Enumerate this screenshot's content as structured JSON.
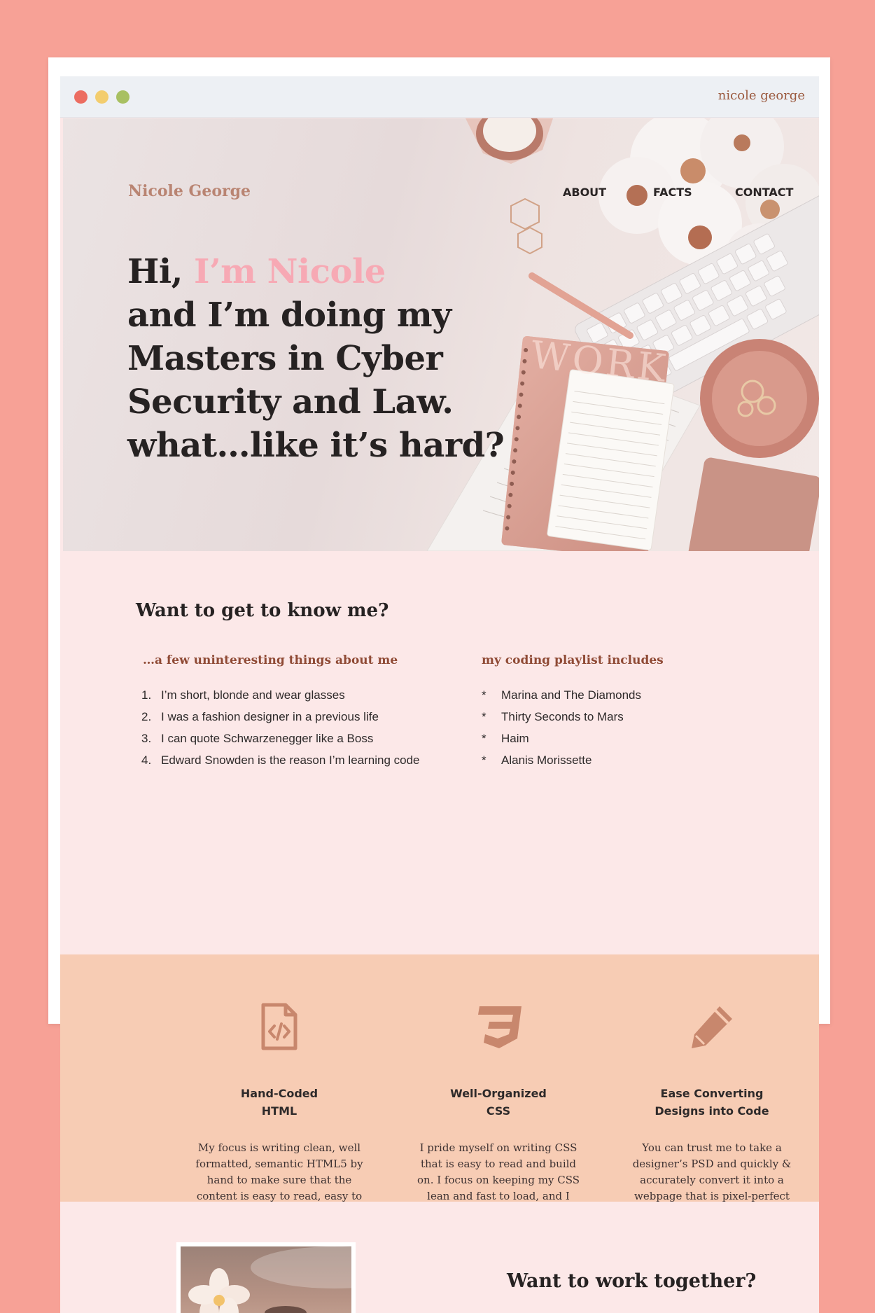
{
  "window": {
    "title": "nicole george"
  },
  "header": {
    "brand": "Nicole George",
    "nav": [
      "ABOUT",
      "FACTS",
      "CONTACT"
    ]
  },
  "hero": {
    "greeting": "Hi,",
    "name": "I’m Nicole",
    "lines": [
      "and I’m doing my",
      "Masters in Cyber",
      "Security and Law.",
      "what…like it’s hard?"
    ],
    "notebook_text": "WORK"
  },
  "about": {
    "heading": "Want to get to know me?",
    "facts_heading": "…a few uninteresting things about me",
    "facts": [
      {
        "marker": "1.",
        "text": "I’m short, blonde and wear glasses"
      },
      {
        "marker": "2.",
        "text": "I was a fashion designer in a previous life"
      },
      {
        "marker": "3.",
        "text": "I can quote Schwarzenegger like a Boss"
      },
      {
        "marker": "4.",
        "text": "Edward Snowden is the reason I’m learning code"
      }
    ],
    "playlist_heading": "my coding playlist includes",
    "playlist": [
      {
        "marker": "*",
        "text": "Marina and The Diamonds"
      },
      {
        "marker": "*",
        "text": "Thirty Seconds to Mars"
      },
      {
        "marker": "*",
        "text": "Haim"
      },
      {
        "marker": "*",
        "text": "Alanis Morissette"
      }
    ]
  },
  "skills": [
    {
      "icon": "html-file-icon",
      "title_line1": "Hand-Coded",
      "title_line2": "HTML",
      "description": "My focus is writing clean, well formatted, semantic HTML5 by hand to make sure that the content is easy to read, easy to collaborate, trouble-shoot and accessible."
    },
    {
      "icon": "css3-icon",
      "title_line1": "Well-Organized",
      "title_line2": "CSS",
      "description": "I pride myself on writing CSS that is easy to read and build on. I focus on keeping my CSS lean and fast to load, and I make it a habit to stay up to date on current best practices."
    },
    {
      "icon": "pencil-icon",
      "title_line1": "Ease Converting",
      "title_line2": "Designs into Code",
      "description": "You can trust me to take a designer’s PSD and quickly & accurately convert it into a webpage that is pixel-perfect match."
    }
  ],
  "work": {
    "heading": "Want to work together?"
  },
  "colors": {
    "background": "#f7a196",
    "accent_pink": "#f7a9b4",
    "section_pink": "#fce8e8",
    "section_peach": "#f7ccb4",
    "icon_brown": "#c8876d"
  }
}
